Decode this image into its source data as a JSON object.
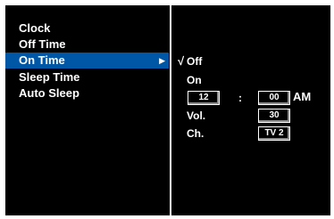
{
  "menu": {
    "items": [
      {
        "label": "Clock"
      },
      {
        "label": "Off Time"
      },
      {
        "label": "On Time"
      },
      {
        "label": "Sleep Time"
      },
      {
        "label": "Auto Sleep"
      }
    ],
    "selected_index": 2,
    "selected_arrow_icon": "right-triangle-icon"
  },
  "on_time": {
    "off_option": "Off",
    "on_option": "On",
    "hour": "12",
    "separator": ":",
    "minute": "00",
    "ampm": "AM",
    "vol_label": "Vol.",
    "vol_value": "30",
    "ch_label": "Ch.",
    "ch_value": "TV 2",
    "checked_option": "Off"
  },
  "colors": {
    "background": "#000000",
    "text": "#ffffff",
    "highlight": "#0057a6",
    "divider": "#ffffff"
  }
}
